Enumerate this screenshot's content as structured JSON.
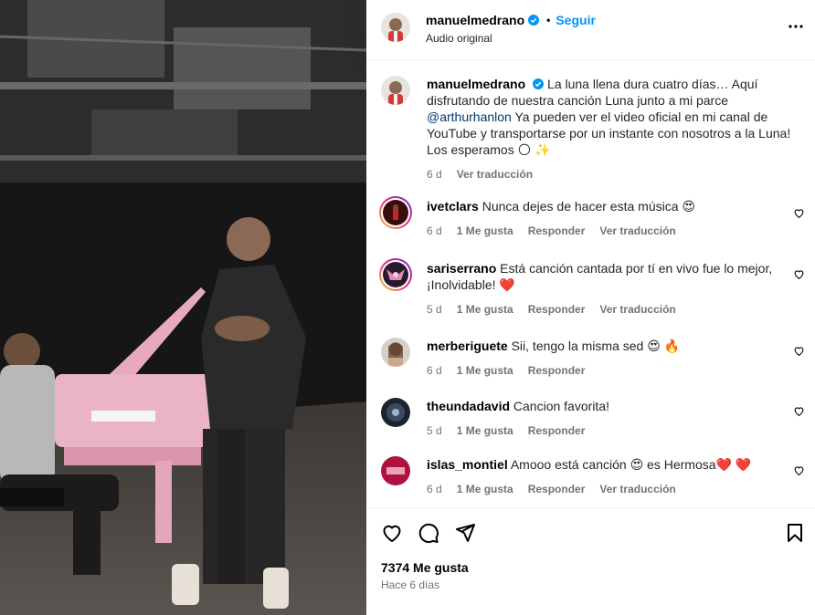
{
  "header": {
    "username": "manuelmedrano",
    "follow_label": "Seguir",
    "subtitle": "Audio original"
  },
  "caption": {
    "username": "manuelmedrano",
    "text_before": "La luna llena dura cuatro días… Aquí disfrutando de nuestra canción Luna junto a mi parce ",
    "mention": "@arthurhanlon",
    "text_after": " Ya pueden ver el video oficial en mi canal de YouTube y transportarse por un instante con nosotros a la Luna! Los esperamos 🌕 ✨",
    "time": "6 d",
    "translate": "Ver traducción"
  },
  "comments": [
    {
      "username": "ivetclars",
      "text": "Nunca dejes de hacer esta música 😍",
      "time": "6 d",
      "likes": "1 Me gusta",
      "reply": "Responder",
      "translate": "Ver traducción"
    },
    {
      "username": "sariserrano",
      "text": "Está canción cantada por tí en vivo fue lo mejor, ¡Inolvidable! ❤️",
      "time": "5 d",
      "likes": "1 Me gusta",
      "reply": "Responder",
      "translate": "Ver traducción"
    },
    {
      "username": "merberiguete",
      "text": "Sii, tengo la misma sed 😍 🔥",
      "time": "6 d",
      "likes": "1 Me gusta",
      "reply": "Responder"
    },
    {
      "username": "theundadavid",
      "text": "Cancion favorita!",
      "time": "5 d",
      "likes": "1 Me gusta",
      "reply": "Responder"
    },
    {
      "username": "islas_montiel",
      "text": "Amooo está canción 😍 es Hermosa❤️ ❤️",
      "time": "6 d",
      "likes": "1 Me gusta",
      "reply": "Responder",
      "translate": "Ver traducción"
    }
  ],
  "footer": {
    "likes": "7374 Me gusta",
    "ago": "Hace 6 días"
  },
  "colors": {
    "accent": "#0095f6",
    "secondary_text": "#737373",
    "verified": "#0095f6"
  },
  "icons": [
    "verified-icon",
    "more-options-icon",
    "heart-icon",
    "comment-icon",
    "share-icon",
    "bookmark-icon"
  ]
}
